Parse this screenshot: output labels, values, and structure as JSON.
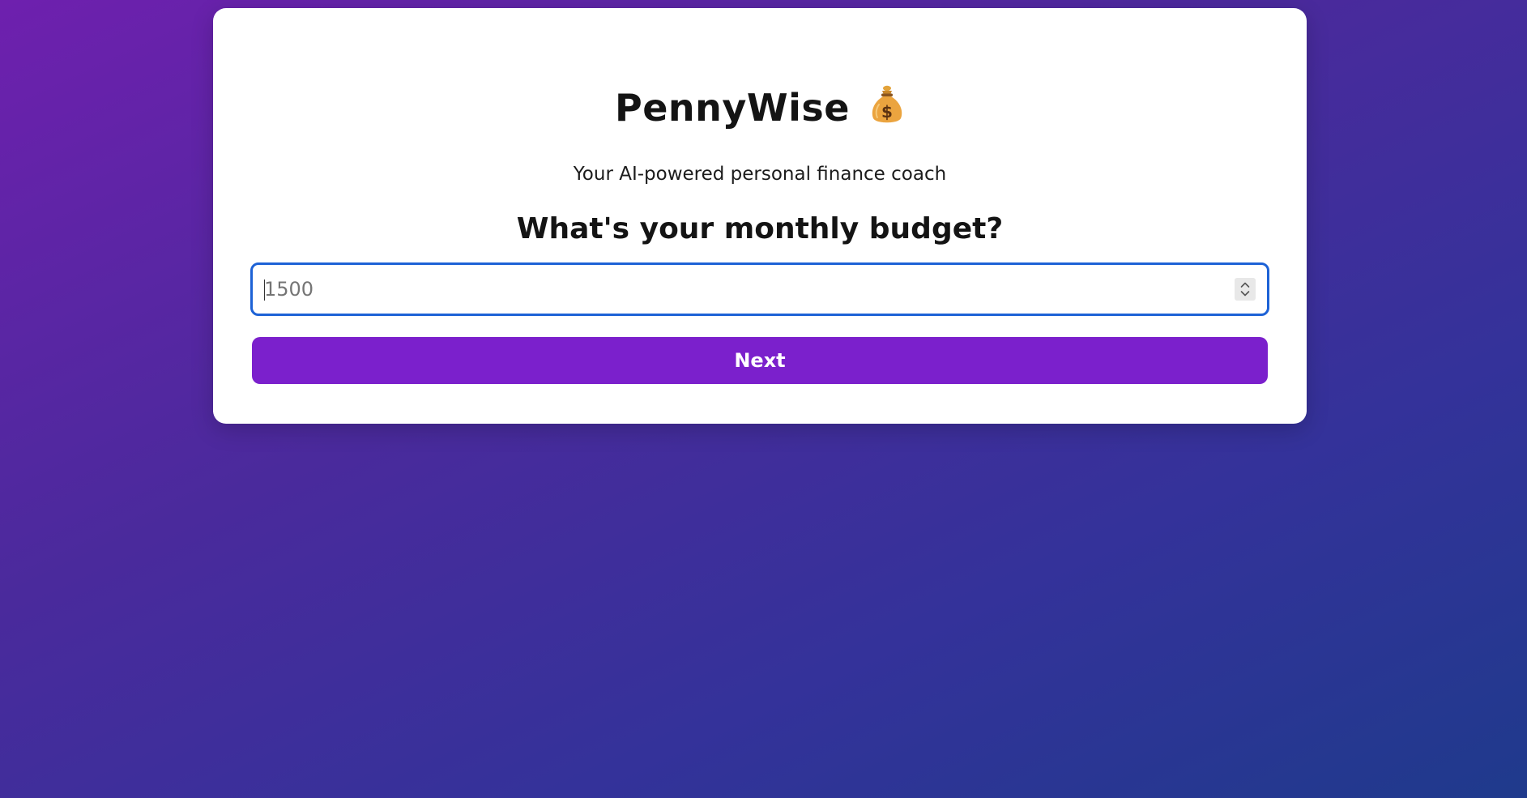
{
  "app": {
    "title": "PennyWise",
    "logo_icon": "money-bag-icon",
    "subtitle": "Your AI-powered personal finance coach"
  },
  "step": {
    "question": "What's your monthly budget?",
    "budget_input": {
      "value": "",
      "placeholder": "1500",
      "type": "number"
    },
    "next_label": "Next"
  },
  "colors": {
    "accent": "#7b20cc",
    "focus_ring": "#1d62d6",
    "background_start": "#6e20ae",
    "background_end": "#1f3a8c",
    "card": "#ffffff"
  }
}
